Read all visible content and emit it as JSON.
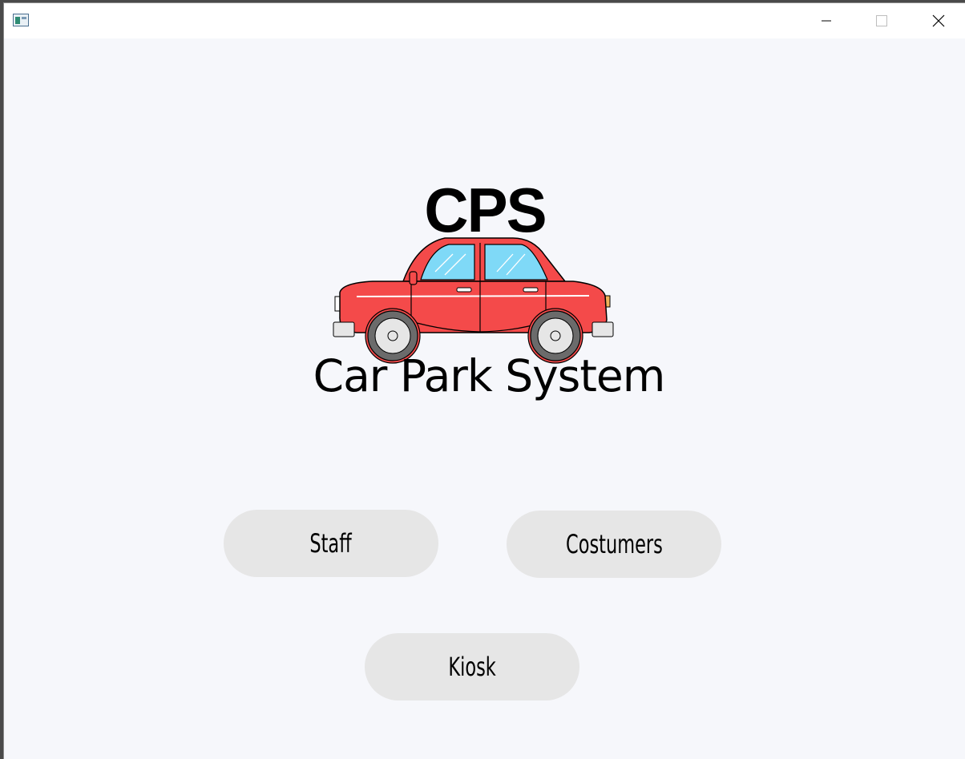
{
  "window": {
    "controls": {
      "minimize_icon": "minimize-icon",
      "maximize_icon": "maximize-icon",
      "close_icon": "close-icon"
    }
  },
  "logo": {
    "abbreviation": "CPS",
    "title": "Car Park System",
    "car_colors": {
      "body": "#f44a4a",
      "window": "#7fd9f7",
      "tire": "#6b6b6b",
      "rim": "#e6e6e6"
    }
  },
  "menu": {
    "staff_label": "Staff",
    "customers_label": "Costumers",
    "kiosk_label": "Kiosk"
  },
  "colors": {
    "background": "#f6f7fb",
    "button_background": "#e6e6e6"
  }
}
